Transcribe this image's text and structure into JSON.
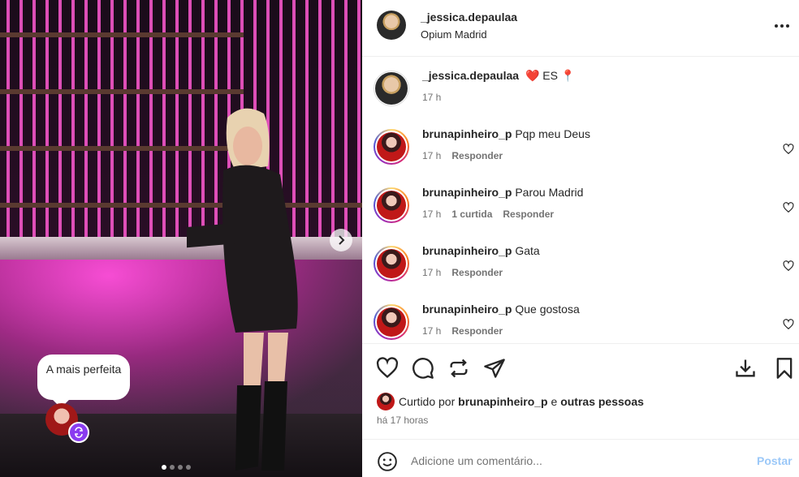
{
  "post": {
    "author": "_jessica.depaulaa",
    "location": "Opium Madrid",
    "image_bubble_text": "A mais perfeita",
    "carousel_dots": 4,
    "carousel_active": 1
  },
  "caption": {
    "username": "_jessica.depaulaa",
    "text": "❤️ ES 📍",
    "time": "17 h"
  },
  "comments": [
    {
      "username": "brunapinheiro_p",
      "text": "Pqp meu Deus",
      "time": "17 h",
      "likes": "",
      "reply": "Responder"
    },
    {
      "username": "brunapinheiro_p",
      "text": "Parou Madrid",
      "time": "17 h",
      "likes": "1 curtida",
      "reply": "Responder"
    },
    {
      "username": "brunapinheiro_p",
      "text": "Gata",
      "time": "17 h",
      "likes": "",
      "reply": "Responder"
    },
    {
      "username": "brunapinheiro_p",
      "text": "Que gostosa",
      "time": "17 h",
      "likes": "",
      "reply": "Responder"
    }
  ],
  "liked_by": {
    "prefix": "Curtido por",
    "user": "brunapinheiro_p",
    "conjunction": "e",
    "others": "outras pessoas"
  },
  "posted_ago": "há 17 horas",
  "add_comment": {
    "placeholder": "Adicione um comentário...",
    "post_label": "Postar"
  },
  "icons": {
    "like": "heart-icon",
    "comment": "comment-icon",
    "share": "repost-icon",
    "send": "send-icon",
    "download": "download-icon",
    "save": "bookmark-icon",
    "emoji": "emoji-icon",
    "more": "more-icon"
  },
  "colors": {
    "post_button": "#9bc8f8",
    "repost_badge": "#8a3cf0",
    "secondary_text": "#737373"
  }
}
